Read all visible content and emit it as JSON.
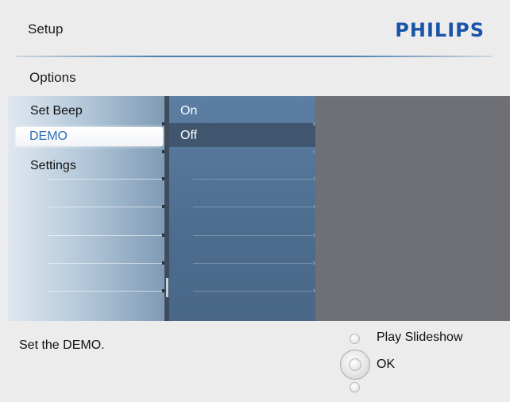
{
  "header": {
    "title": "Setup",
    "brand": "PHILIPS",
    "brand_color": "#1b55a8"
  },
  "breadcrumb": {
    "label": "Options"
  },
  "menu": {
    "items": [
      {
        "label": "Set Beep",
        "selected": false
      },
      {
        "label": "DEMO",
        "selected": true
      },
      {
        "label": "Settings",
        "selected": false
      }
    ]
  },
  "submenu": {
    "items": [
      {
        "label": "On",
        "selected": false
      },
      {
        "label": "Off",
        "selected": true
      }
    ]
  },
  "footer": {
    "hint": "Set the DEMO.",
    "play_label": "Play Slideshow",
    "ok_label": "OK"
  },
  "colors": {
    "accent": "#2e6fb4",
    "panel_bg": "#6e7075",
    "submenu_bg": "#4d6d8f"
  }
}
